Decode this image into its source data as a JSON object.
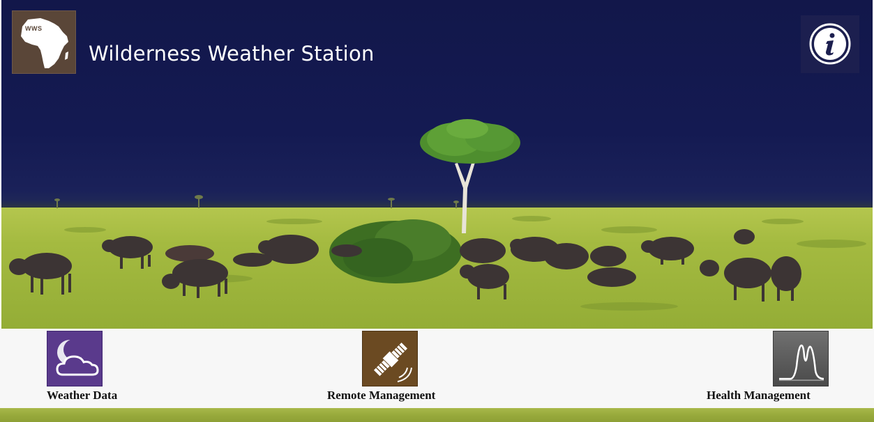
{
  "header": {
    "logo_text": "WWS",
    "title": "Wilderness Weather Station",
    "info_icon": "info-icon"
  },
  "nav": {
    "items": [
      {
        "label": "Weather Data",
        "icon": "cloud-moon-icon",
        "tile_color": "#5a3a8c"
      },
      {
        "label": "Remote Management",
        "icon": "satellite-icon",
        "tile_color": "#6b4a22"
      },
      {
        "label": "Health Management",
        "icon": "waveform-icon",
        "tile_color": "#555555"
      }
    ]
  },
  "colors": {
    "sky": "#141a52",
    "grass": "#9cb23c",
    "logo_bg": "#5a4638",
    "info_bg": "#1c1f4f"
  }
}
